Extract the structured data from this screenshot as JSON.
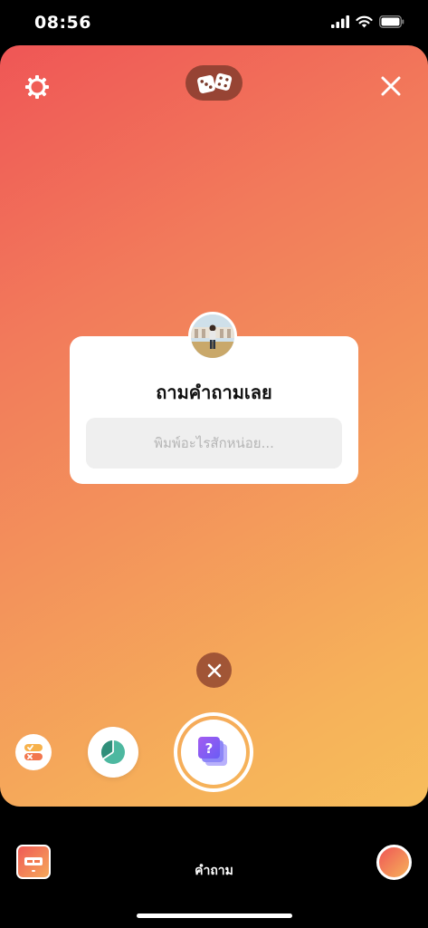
{
  "status_bar": {
    "time": "08:56"
  },
  "question_sticker": {
    "title": "ถามคำถามเลย",
    "input_placeholder": "พิมพ์อะไรสักหน่อย..."
  },
  "bottom_bar": {
    "mode_label": "คำถาม"
  },
  "icons": {
    "settings": "gear-icon",
    "randomize": "dice-icon",
    "close": "close-icon",
    "discard": "close-icon",
    "quiz": "quiz-icon",
    "poll": "poll-icon",
    "question": "question-sticker-icon"
  },
  "colors": {
    "gradient_start": "#ef5656",
    "gradient_end": "#f7bd5b",
    "accent_purple": "#8e5cf5",
    "poll_green": "#4db8a0"
  }
}
